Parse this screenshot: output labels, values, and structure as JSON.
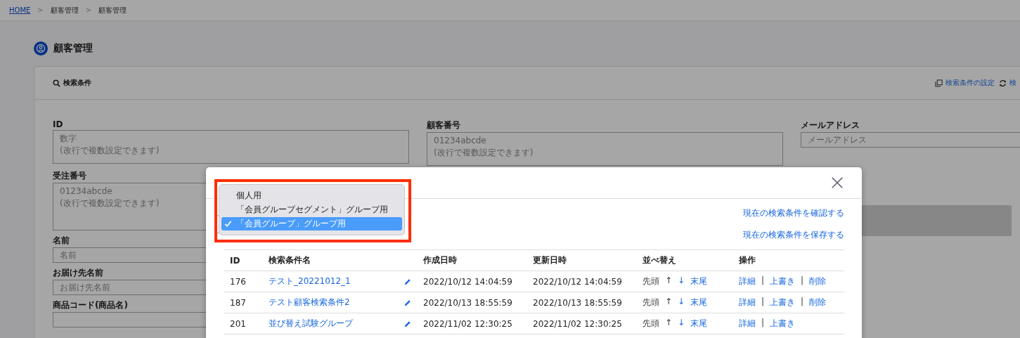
{
  "breadcrumb": {
    "items": [
      {
        "label": "HOME",
        "link": true
      },
      {
        "label": "顧客管理",
        "link": false
      },
      {
        "label": "顧客管理",
        "link": false
      }
    ],
    "separator": ">"
  },
  "page_title": "顧客管理",
  "search_panel": {
    "title": "検索条件",
    "actions": [
      {
        "label": "検索条件の設定"
      },
      {
        "label": "検"
      }
    ],
    "fields": [
      {
        "label": "ID",
        "kind": "textarea",
        "placeholder": "数字\n(改行で複数設定できます)"
      },
      {
        "label": "顧客番号",
        "kind": "textarea",
        "placeholder": "01234abcde\n(改行で複数設定できます)"
      },
      {
        "label": "メールアドレス",
        "kind": "input",
        "placeholder": "メールアドレス"
      },
      {
        "label": "受注番号",
        "kind": "tall",
        "placeholder": "01234abcde\n(改行で複数設定できます)"
      },
      {
        "label": "名前",
        "kind": "input",
        "placeholder": "名前"
      },
      {
        "label": "お届け先名前",
        "kind": "input",
        "placeholder": "お届け先名前"
      },
      {
        "label": "商品コード(商品名)",
        "kind": "input"
      }
    ]
  },
  "modal": {
    "links": [
      "現在の検索条件を確認する",
      "現在の検索条件を保存する"
    ],
    "dropdown": {
      "options": [
        {
          "label": "個人用",
          "selected": false
        },
        {
          "label": "「会員グループセグメント」グループ用",
          "selected": false
        },
        {
          "label": "「会員グループ」グループ用",
          "selected": true
        }
      ]
    },
    "table": {
      "columns": [
        "ID",
        "検索条件名",
        "作成日時",
        "更新日時",
        "並べ替え",
        "操作"
      ],
      "action_separator": "|",
      "rows": [
        {
          "id": "176",
          "name": "テスト_20221012_1",
          "created": "2022/10/12 14:04:59",
          "updated": "2022/10/12 14:04:59",
          "sort": [
            {
              "text": "先頭",
              "link": false
            },
            {
              "text": "↑",
              "link": false
            },
            {
              "text": "↓",
              "link": true
            },
            {
              "text": "末尾",
              "link": true
            }
          ],
          "actions": [
            "詳細",
            "上書き",
            "削除"
          ]
        },
        {
          "id": "187",
          "name": "テスト顧客検索条件2",
          "created": "2022/10/13 18:55:59",
          "updated": "2022/10/13 18:55:59",
          "sort": [
            {
              "text": "先頭",
              "link": false
            },
            {
              "text": "↑",
              "link": false
            },
            {
              "text": "↓",
              "link": true
            },
            {
              "text": "末尾",
              "link": true
            }
          ],
          "actions": [
            "詳細",
            "上書き",
            "削除"
          ]
        },
        {
          "id": "201",
          "name": "並び替え試験グループ",
          "created": "2022/11/02 12:30:25",
          "updated": "2022/11/02 12:30:25",
          "sort": [
            {
              "text": "先頭",
              "link": false
            },
            {
              "text": "↑",
              "link": false
            },
            {
              "text": "↓",
              "link": true
            },
            {
              "text": "末尾",
              "link": true
            }
          ],
          "actions": [
            "詳細",
            "上書き"
          ]
        }
      ]
    }
  }
}
